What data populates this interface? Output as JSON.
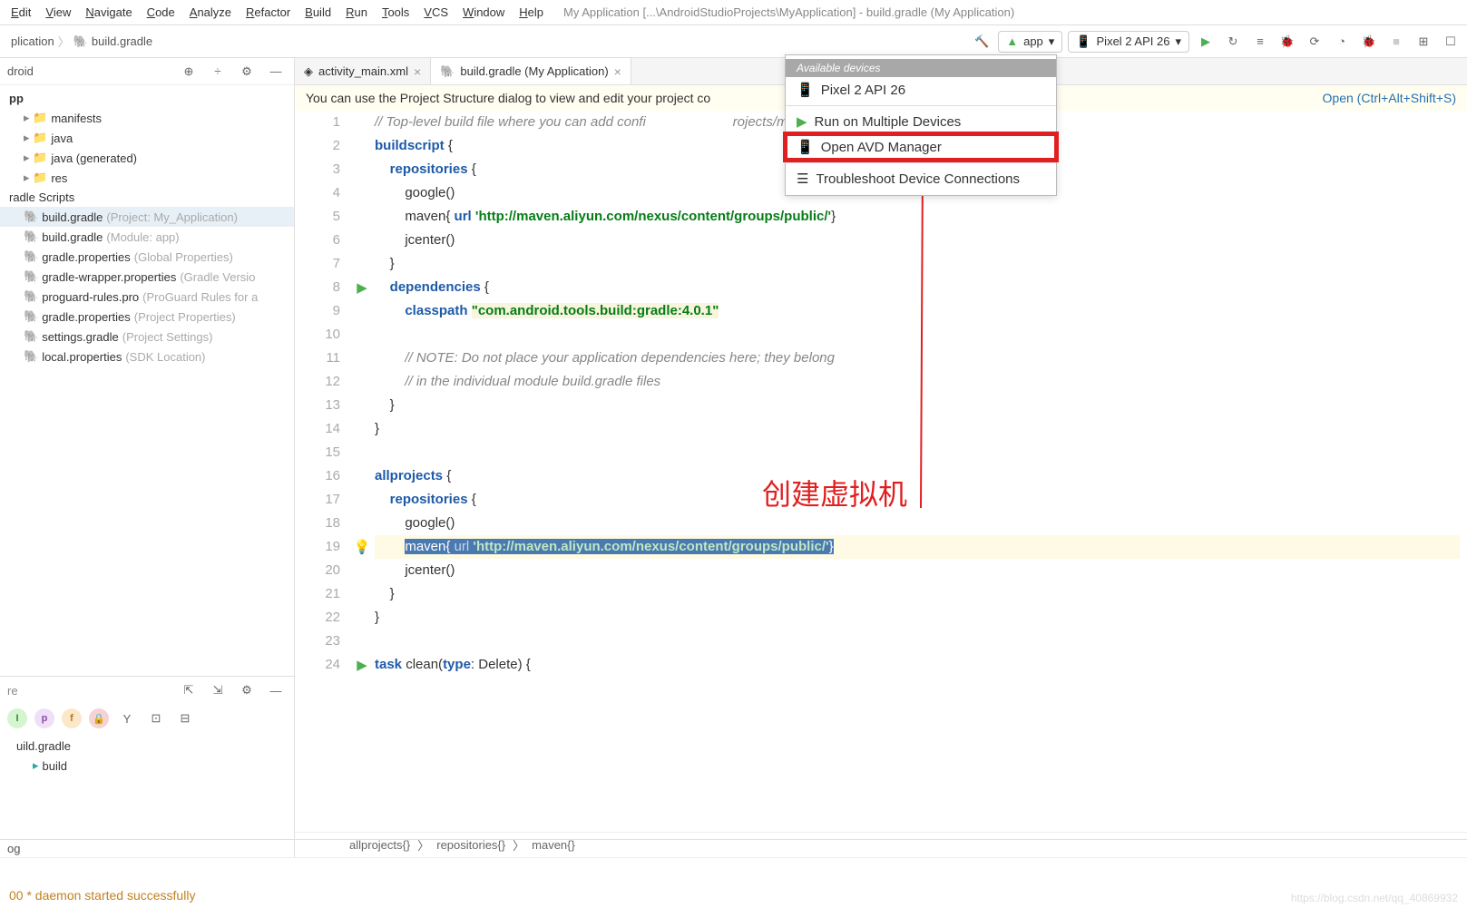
{
  "menubar": {
    "items": [
      "Edit",
      "View",
      "Navigate",
      "Code",
      "Analyze",
      "Refactor",
      "Build",
      "Run",
      "Tools",
      "VCS",
      "Window",
      "Help"
    ],
    "title": "My Application [...\\AndroidStudioProjects\\MyApplication] - build.gradle (My Application)"
  },
  "breadcrumb": {
    "project": "plication",
    "file": "build.gradle"
  },
  "run": {
    "config": "app",
    "device": "Pixel 2 API 26",
    "dropdown_header": "Available devices",
    "items": [
      "Pixel 2 API 26",
      "Run on Multiple Devices",
      "Open AVD Manager",
      "Troubleshoot Device Connections"
    ]
  },
  "project_panel": {
    "scope": "droid",
    "app": "pp",
    "nodes": [
      "manifests",
      "java",
      "java (generated)",
      "res"
    ],
    "gradle_section": "radle Scripts",
    "scripts": [
      {
        "name": "build.gradle",
        "hint": "(Project: My_Application)",
        "sel": true
      },
      {
        "name": "build.gradle",
        "hint": "(Module: app)"
      },
      {
        "name": "gradle.properties",
        "hint": "(Global Properties)"
      },
      {
        "name": "gradle-wrapper.properties",
        "hint": "(Gradle Versio"
      },
      {
        "name": "proguard-rules.pro",
        "hint": "(ProGuard Rules for a"
      },
      {
        "name": "gradle.properties",
        "hint": "(Project Properties)"
      },
      {
        "name": "settings.gradle",
        "hint": "(Project Settings)"
      },
      {
        "name": "local.properties",
        "hint": "(SDK Location)"
      }
    ]
  },
  "structure": {
    "title": "re",
    "file": "uild.gradle",
    "child": "build"
  },
  "tabs": [
    {
      "name": "activity_main.xml",
      "active": false
    },
    {
      "name": "build.gradle (My Application)",
      "active": true
    }
  ],
  "banner": {
    "text": "You can use the Project Structure dialog to view and edit your project co",
    "link": "Open (Ctrl+Alt+Shift+S)"
  },
  "code": [
    {
      "n": 1,
      "html": "<span class='cm'>// Top-level build file where you can add confi                       rojects/modules.</span>"
    },
    {
      "n": 2,
      "html": "<span class='kw'>buildscript</span> {"
    },
    {
      "n": 3,
      "html": "    <span class='kw'>repositories</span> {"
    },
    {
      "n": 4,
      "html": "        google()"
    },
    {
      "n": 5,
      "html": "        maven{ <span class='kw'>url</span> <span class='str'>'http://maven.aliyun.com/nexus/content/groups/public/'</span>}"
    },
    {
      "n": 6,
      "html": "        jcenter()"
    },
    {
      "n": 7,
      "html": "    }"
    },
    {
      "n": 8,
      "html": "    <span class='kw'>dependencies</span> {",
      "run": true
    },
    {
      "n": 9,
      "html": "        <span class='kw'>classpath</span> <span class='strhl'>\"com.android.tools.build:gradle:4.0.1\"</span>"
    },
    {
      "n": 10,
      "html": ""
    },
    {
      "n": 11,
      "html": "        <span class='cm'>// NOTE: Do not place your application dependencies here; they belong</span>"
    },
    {
      "n": 12,
      "html": "        <span class='cm'>// in the individual module build.gradle files</span>"
    },
    {
      "n": 13,
      "html": "    }"
    },
    {
      "n": 14,
      "html": "}"
    },
    {
      "n": 15,
      "html": ""
    },
    {
      "n": 16,
      "html": "<span class='kw'>allprojects</span> {"
    },
    {
      "n": 17,
      "html": "    <span class='kw'>repositories</span> {"
    },
    {
      "n": 18,
      "html": "        google()"
    },
    {
      "n": 19,
      "html": "        <span class='line-selected'>maven{ <span style='color:#c2d7ec'>url</span> <span class='str'>'http://maven.aliyun.com/nexus/content/groups/public/'</span>}</span>",
      "caret": true
    },
    {
      "n": 20,
      "html": "        jcenter()"
    },
    {
      "n": 21,
      "html": "    }"
    },
    {
      "n": 22,
      "html": "}"
    },
    {
      "n": 23,
      "html": ""
    },
    {
      "n": 24,
      "html": "<span class='kw'>task</span> clean(<span class='kw'>type</span>: Delete) {",
      "run": true
    }
  ],
  "crumbs": [
    "allprojects{}",
    "repositories{}",
    "maven{}"
  ],
  "bottom_tab": "og",
  "build_log": "00  * daemon started successfully",
  "annotation": "创建虚拟机",
  "watermark": "https://blog.csdn.net/qq_40869932"
}
